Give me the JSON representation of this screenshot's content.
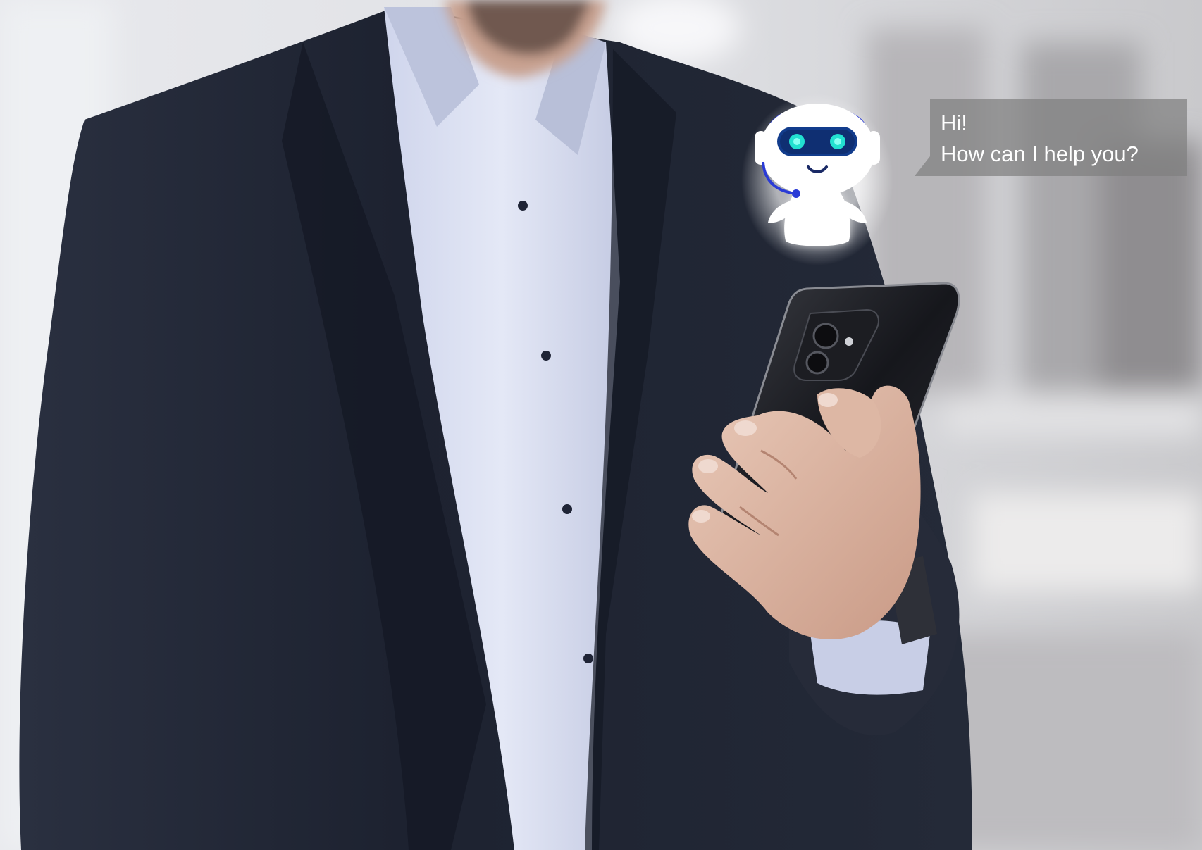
{
  "chat_bubble": {
    "line1": "Hi!",
    "line2": "How can I help you?"
  },
  "colors": {
    "bubble_bg": "#808080",
    "bubble_text": "#ffffff",
    "robot_body": "#ffffff",
    "robot_visor": "#123c8c",
    "robot_eyes": "#22e0d0",
    "headset": "#2a3bd6",
    "suit": "#1a1f2e",
    "shirt": "#dde2f4"
  },
  "icons": {
    "robot": "chatbot-robot-icon"
  }
}
